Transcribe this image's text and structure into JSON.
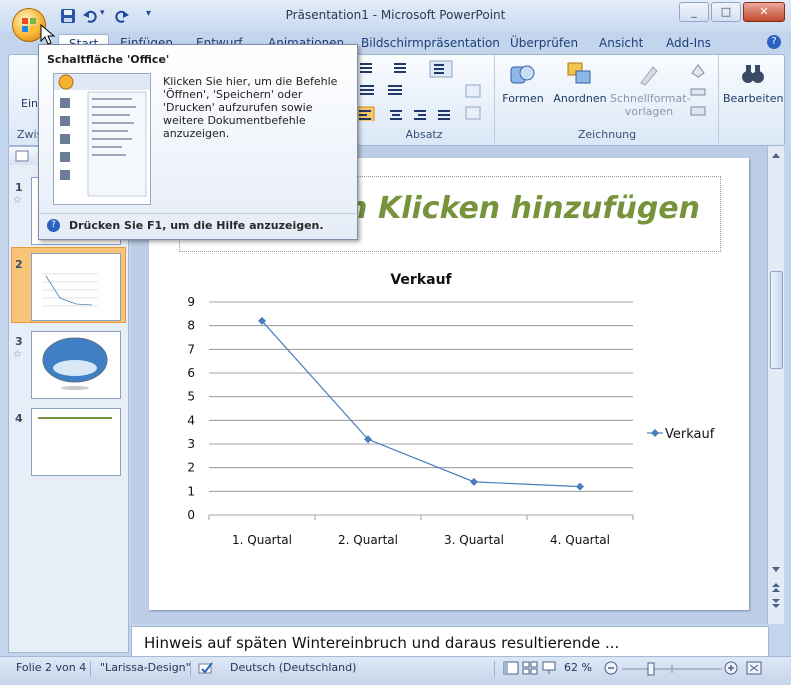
{
  "window": {
    "title": "Präsentation1 - Microsoft PowerPoint"
  },
  "tabs": [
    "Start",
    "Einfügen",
    "Entwurf",
    "Animationen",
    "Bildschirmpräsentation",
    "Überprüfen",
    "Ansicht",
    "Add-Ins"
  ],
  "ribbon": {
    "partial_left_label": "Einf",
    "partial_group_label": "Zwis",
    "absatz_label": "Absatz",
    "zeichnung_label": "Zeichnung",
    "formen": "Formen",
    "anordnen": "Anordnen",
    "schnellformat": "Schnellformat-",
    "vorlagen": "vorlagen",
    "bearbeiten": "Bearbeiten"
  },
  "tooltip": {
    "title": "Schaltfläche 'Office'",
    "body": "Klicken Sie hier, um die Befehle 'Öffnen', 'Speichern' oder 'Drucken' aufzurufen sowie weitere Dokumentbefehle anzuzeigen.",
    "footer": "Drücken Sie F1, um die Hilfe anzuzeigen.",
    "menu_preview_items": [
      "Neu",
      "Öffnen",
      "Speichern",
      "Speichern unter",
      "Drucken",
      "Vorbereiten",
      "Senden",
      "Veröffentlichen",
      "Schließen"
    ]
  },
  "thumbnails": [
    {
      "num": "1"
    },
    {
      "num": "2"
    },
    {
      "num": "3"
    },
    {
      "num": "4"
    }
  ],
  "slide": {
    "title_text": "Durch Klicken hinzufügen"
  },
  "chart_data": {
    "type": "line",
    "title": "Verkauf",
    "categories": [
      "1. Quartal",
      "2. Quartal",
      "3. Quartal",
      "4. Quartal"
    ],
    "series": [
      {
        "name": "Verkauf",
        "values": [
          8.2,
          3.2,
          1.4,
          1.2
        ],
        "color": "#4a7ebb"
      }
    ],
    "ylim": [
      0,
      9
    ],
    "yticks": [
      0,
      1,
      2,
      3,
      4,
      5,
      6,
      7,
      8,
      9
    ],
    "grid": true,
    "legend": "right"
  },
  "notes": {
    "text": "Hinweis auf späten Wintereinbruch und daraus resultierende ..."
  },
  "status": {
    "slide": "Folie 2 von 4",
    "theme": "\"Larissa-Design\"",
    "language": "Deutsch (Deutschland)",
    "zoom": "62 %"
  },
  "colors": {
    "accent": "#4a7ebb",
    "title_green": "#77943c"
  }
}
